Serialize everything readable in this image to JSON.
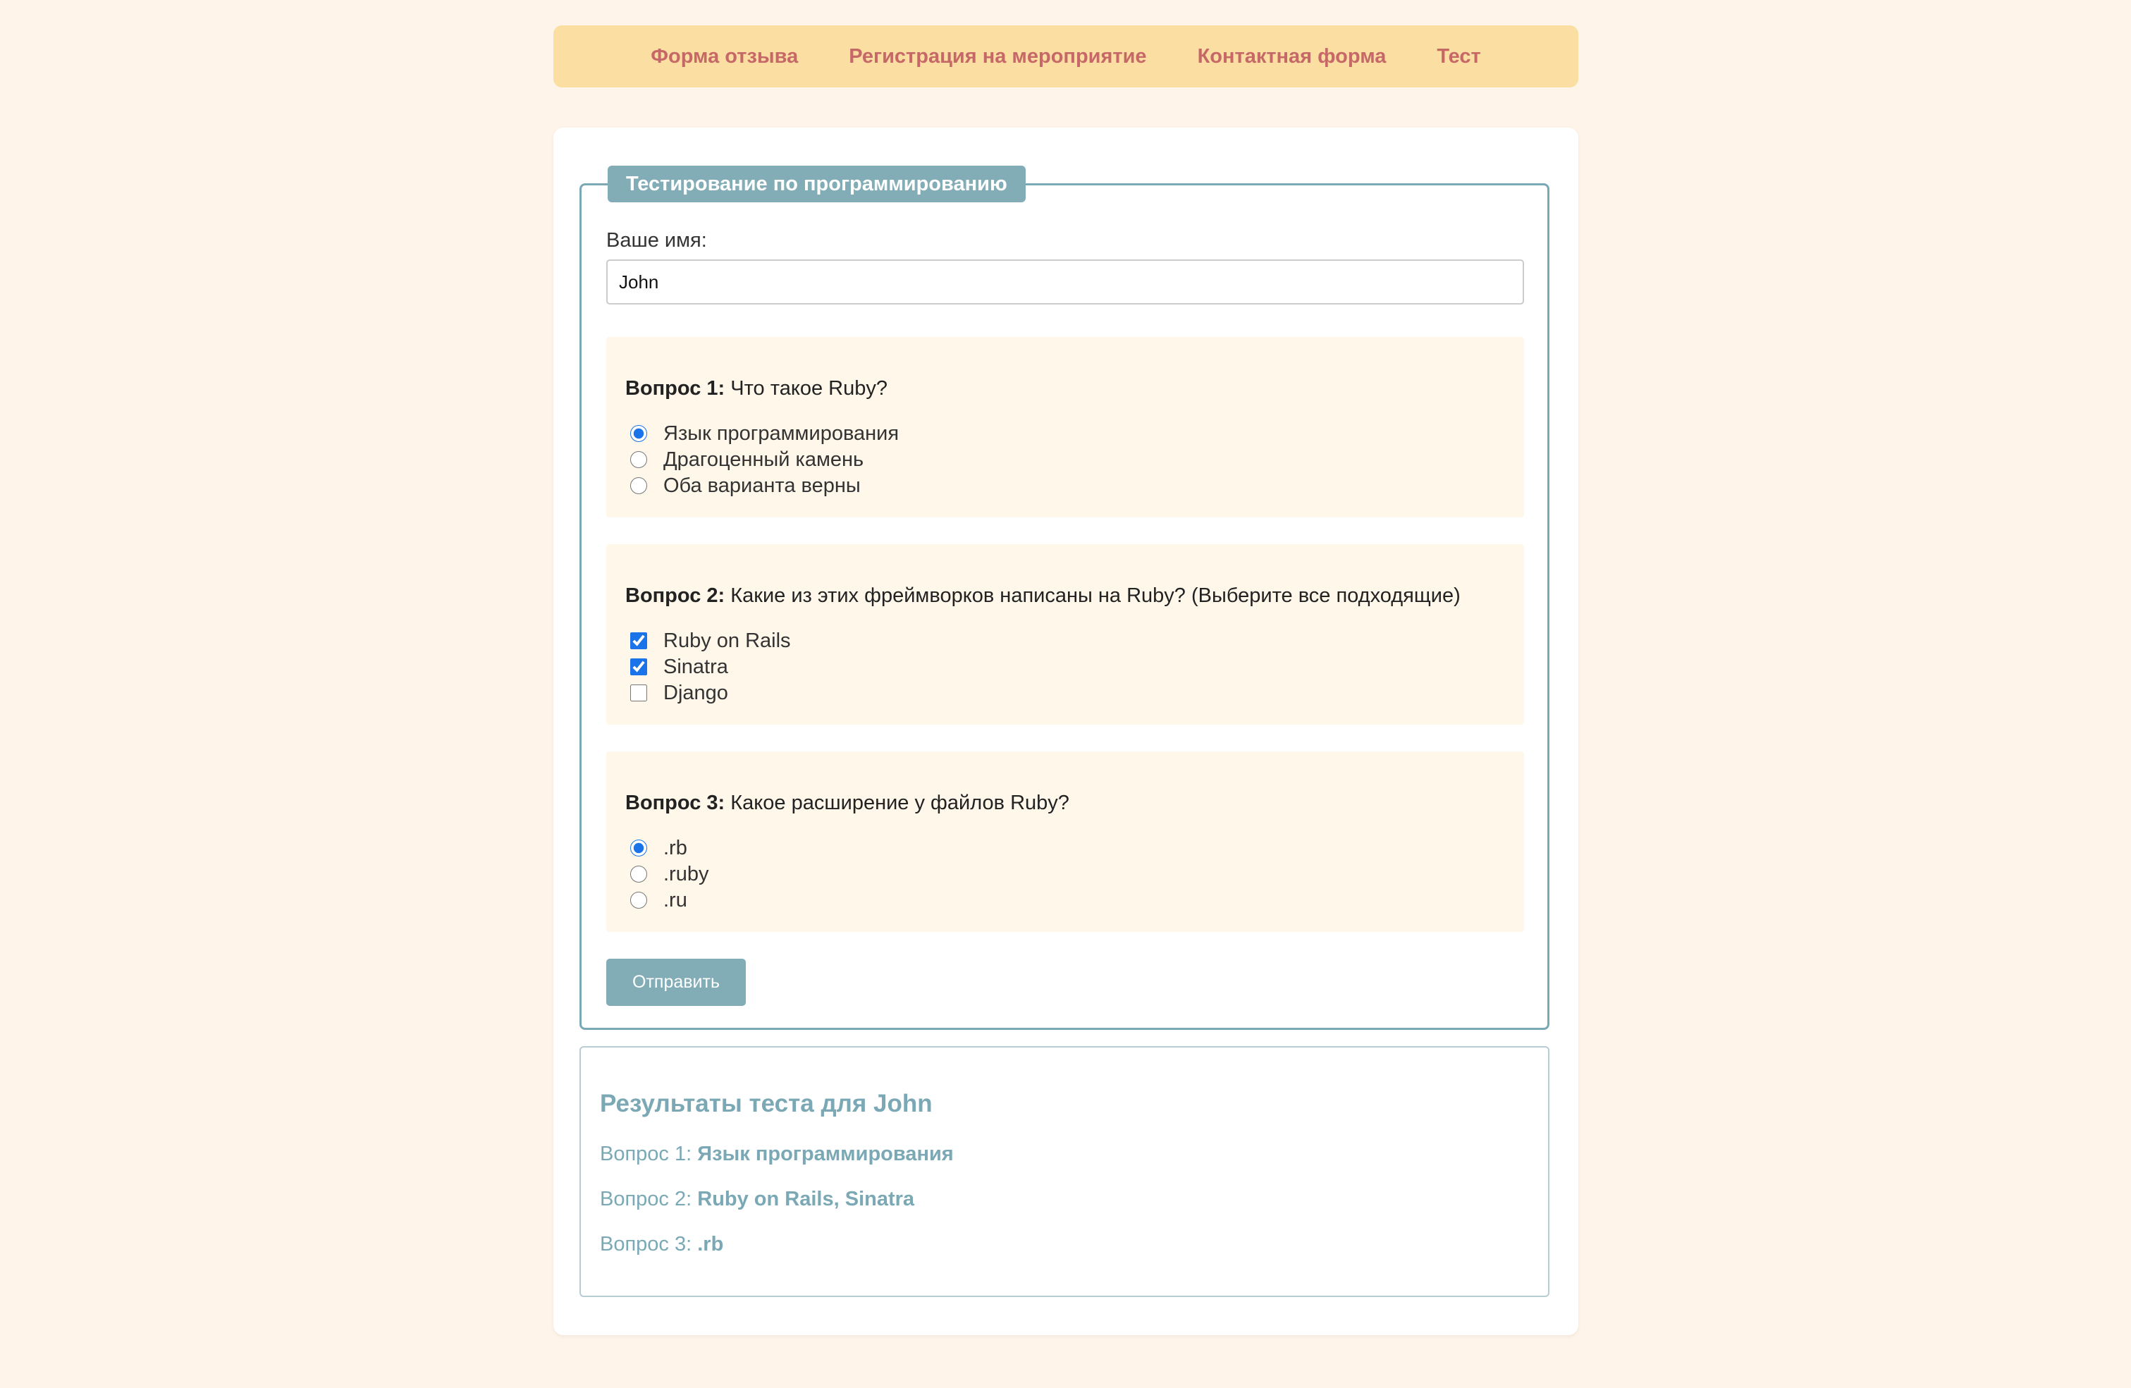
{
  "nav": {
    "links": [
      {
        "label": "Форма отзыва"
      },
      {
        "label": "Регистрация на мероприятие"
      },
      {
        "label": "Контактная форма"
      },
      {
        "label": "Тест"
      }
    ]
  },
  "form": {
    "legend": "Тестирование по программированию",
    "name_label": "Ваше имя:",
    "name_value": "John",
    "questions": [
      {
        "number_label": "Вопрос 1:",
        "text": "Что такое Ruby?",
        "type": "radio",
        "options": [
          {
            "label": "Язык программирования",
            "checked": true
          },
          {
            "label": "Драгоценный камень",
            "checked": false
          },
          {
            "label": "Оба варианта верны",
            "checked": false
          }
        ]
      },
      {
        "number_label": "Вопрос 2:",
        "text": "Какие из этих фреймворков написаны на Ruby? (Выберите все подходящие)",
        "type": "checkbox",
        "options": [
          {
            "label": "Ruby on Rails",
            "checked": true
          },
          {
            "label": "Sinatra",
            "checked": true
          },
          {
            "label": "Django",
            "checked": false
          }
        ]
      },
      {
        "number_label": "Вопрос 3:",
        "text": "Какое расширение у файлов Ruby?",
        "type": "radio",
        "options": [
          {
            "label": ".rb",
            "checked": true
          },
          {
            "label": ".ruby",
            "checked": false
          },
          {
            "label": ".ru",
            "checked": false
          }
        ]
      }
    ],
    "submit_label": "Отправить"
  },
  "results": {
    "title": "Результаты теста для John",
    "lines": [
      {
        "prefix": "Вопрос 1:",
        "answer": "Язык программирования"
      },
      {
        "prefix": "Вопрос 2:",
        "answer": "Ruby on Rails, Sinatra"
      },
      {
        "prefix": "Вопрос 3:",
        "answer": ".rb"
      }
    ]
  },
  "colors": {
    "page_background": "#fef4e9",
    "nav_background": "#fbdfa2",
    "nav_link": "#c76868",
    "accent": "#82adb7",
    "question_background": "#fef7ea"
  }
}
